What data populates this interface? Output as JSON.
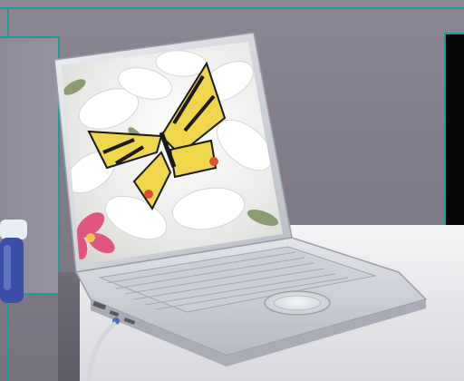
{
  "scene": {
    "colors": {
      "frame_accent": "#1f9a95",
      "backdrop": "#807c8a",
      "laptop_silver": "#cfd1d6",
      "butterfly_yellow": "#f0d64a"
    }
  }
}
